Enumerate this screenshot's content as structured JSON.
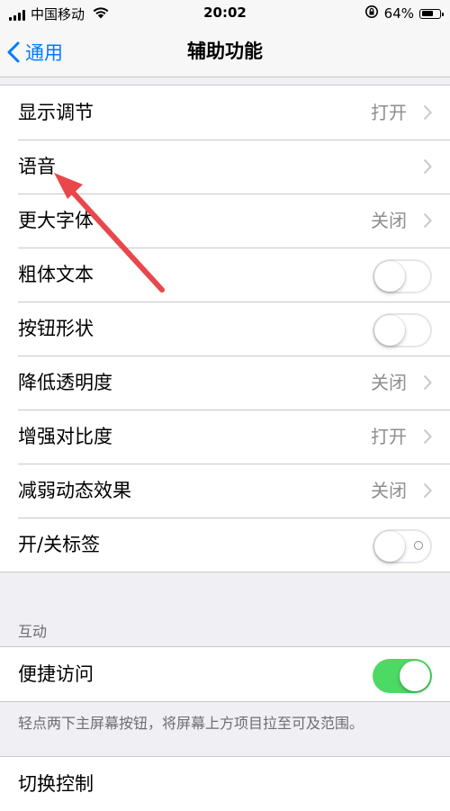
{
  "status_bar": {
    "carrier": "中国移动",
    "time": "20:02",
    "battery_percent": "64%",
    "battery_level": 0.64
  },
  "nav": {
    "back_label": "通用",
    "title": "辅助功能"
  },
  "settings": {
    "display": {
      "label": "显示调节",
      "value": "打开"
    },
    "speech": {
      "label": "语音"
    },
    "larger_text": {
      "label": "更大字体",
      "value": "关闭"
    },
    "bold_text": {
      "label": "粗体文本",
      "toggle_on": false
    },
    "button_shapes": {
      "label": "按钮形状",
      "toggle_on": false
    },
    "reduce_transparency": {
      "label": "降低透明度",
      "value": "关闭"
    },
    "increase_contrast": {
      "label": "增强对比度",
      "value": "打开"
    },
    "reduce_motion": {
      "label": "减弱动态效果",
      "value": "关闭"
    },
    "on_off_labels": {
      "label": "开/关标签",
      "toggle_on": false
    }
  },
  "interaction": {
    "header": "互动",
    "reachability": {
      "label": "便捷访问",
      "toggle_on": true
    },
    "reachability_note": "轻点两下主屏幕按钮，将屏幕上方项目拉至可及范围。",
    "switch_control": {
      "label": "切换控制"
    }
  },
  "colors": {
    "accent": "#007aff",
    "toggle_on": "#4cd964",
    "annotation_arrow": "#e8474b"
  }
}
